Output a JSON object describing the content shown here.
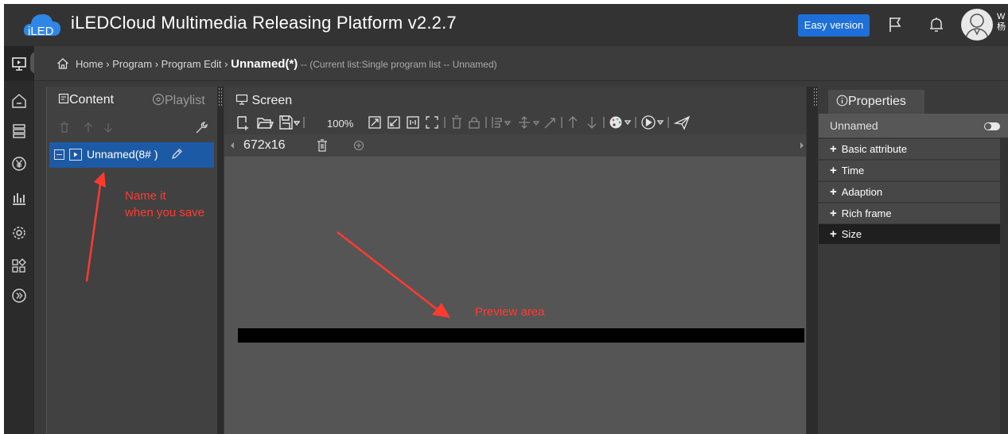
{
  "app": {
    "logo_text": "iLED",
    "title": "iLEDCloud Multimedia Releasing Platform v2.2.7",
    "easy_version_label": "Easy version",
    "user_cut_text": "W 杨"
  },
  "breadcrumb": {
    "home": "Home",
    "sep": " › ",
    "program": "Program",
    "program_edit": "Program Edit",
    "current": "Unnamed(*)",
    "subtext": "-- (Current list:Single program list -- Unnamed)"
  },
  "left_panel": {
    "tab_content": "Content",
    "tab_playlist": "Playlist",
    "tree_item_label": "Unnamed(8# )"
  },
  "screen_panel": {
    "title": "Screen",
    "zoom": "100%",
    "size_tab": "672x16"
  },
  "properties": {
    "tab": "Properties",
    "name": "Unnamed",
    "rows": [
      {
        "label": "Basic attribute"
      },
      {
        "label": "Time"
      },
      {
        "label": "Adaption"
      },
      {
        "label": "Rich frame"
      },
      {
        "label": "Size"
      }
    ]
  },
  "annotations": {
    "name_it_line1": "Name it",
    "name_it_line2": "when you save",
    "preview": "Preview area"
  },
  "colors": {
    "accent": "#1e6fd9",
    "selected": "#1d5aa6",
    "annotation": "#ff3b30"
  },
  "icons": {
    "rail": [
      "screen-icon",
      "home-icon",
      "stack-icon",
      "yen-icon",
      "chart-icon",
      "gear-icon",
      "apps-icon",
      "expand-icon"
    ],
    "top": [
      "flag-icon",
      "bell-icon",
      "avatar-icon"
    ]
  }
}
